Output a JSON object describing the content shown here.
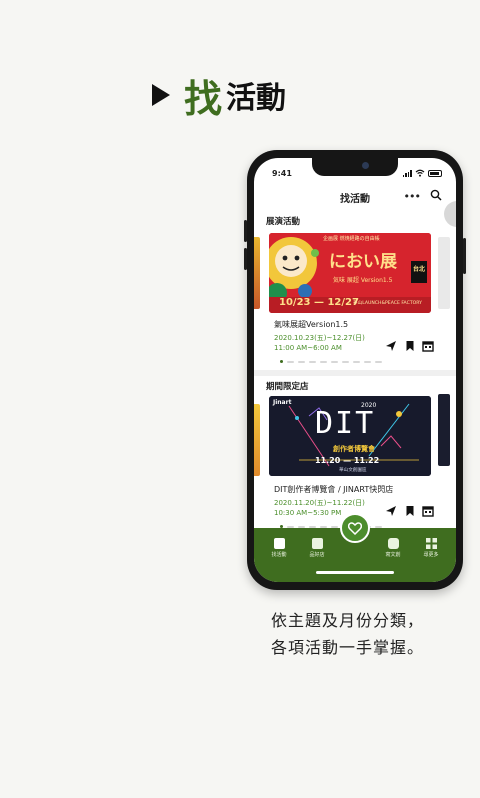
{
  "headline": {
    "accent": "找",
    "rest": "活動"
  },
  "status": {
    "time": "9:41"
  },
  "nav": {
    "title": "找活動",
    "more": "•••"
  },
  "sections": [
    {
      "title": "展演活動",
      "poster": {
        "top_caption": "企画展 燃焼経路の自由帳",
        "title": "におい展",
        "badge": "台北",
        "subtitle": "気味 展超 Version1.5",
        "dates": "10/23 — 12/27",
        "venue": "華山LAUNCH&PEACE FACTORY"
      },
      "event_title": "氣味展超Version1.5",
      "event_date": "2020.10.23(五)~12.27(日)",
      "event_time": "11:00 AM~6:00 AM"
    },
    {
      "title": "期間限定店",
      "poster": {
        "brand": "Jinart",
        "year": "2020",
        "title": "DIT",
        "subtitle": "創作者博覽會",
        "dates": "11.20 — 11.22",
        "venue": "華山文創園區"
      },
      "event_title": "DIT創作者博覽會 / JINART快閃店",
      "event_date": "2020.11.20(五)~11.22(日)",
      "event_time": "10:30 AM~5:30 PM"
    }
  ],
  "tabs": [
    {
      "label": "找活動",
      "icon": "calendar-icon"
    },
    {
      "label": "品好店",
      "icon": "shop-icon"
    },
    {
      "label": "",
      "icon": "heart-icon"
    },
    {
      "label": "寫文創",
      "icon": "chat-icon"
    },
    {
      "label": "尋更多",
      "icon": "grid-icon"
    }
  ],
  "caption": {
    "line1": "依主題及月份分類，",
    "line2": "各項活動一手掌握。"
  },
  "colors": {
    "brand_green": "#3f6d1f",
    "date_green": "#4a8e2a",
    "background": "#f6f6f3"
  }
}
